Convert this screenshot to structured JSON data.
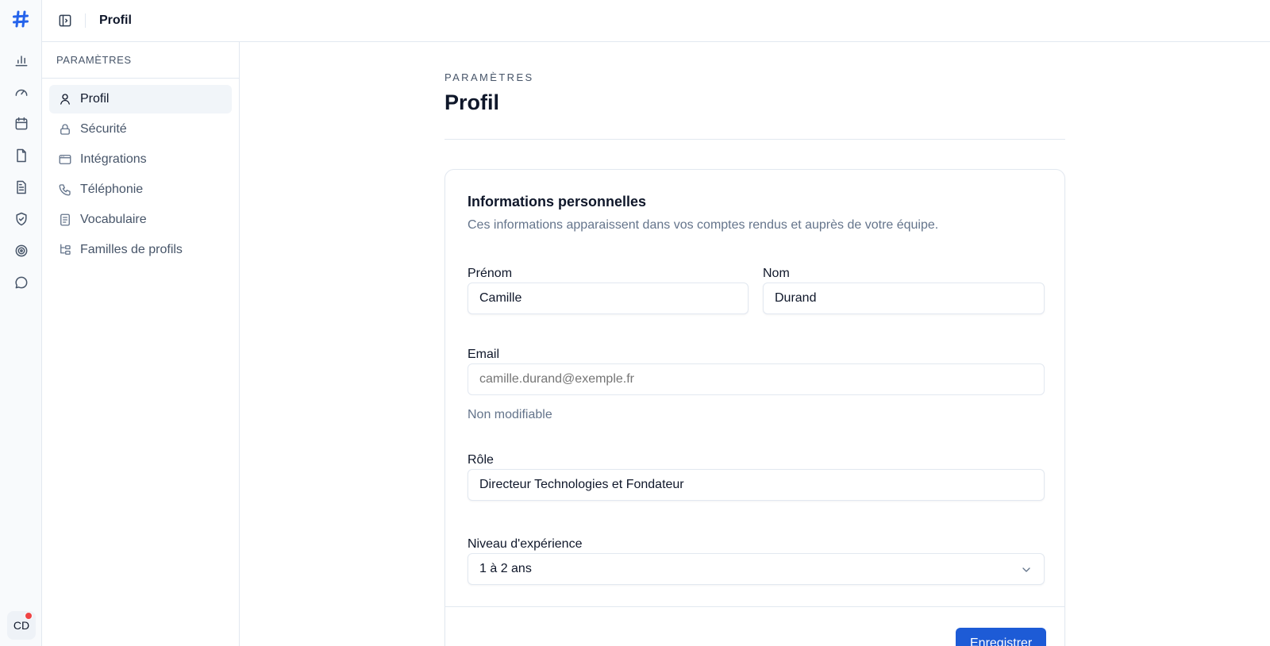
{
  "colors": {
    "accent": "#1d5bd6",
    "notification": "#ef4444"
  },
  "rail": {
    "icons": [
      "hash-logo-icon",
      "bar-chart-icon",
      "gauge-icon",
      "calendar-icon",
      "file-icon",
      "document-icon",
      "shield-check-icon",
      "target-icon",
      "chat-bubble-icon"
    ],
    "avatar_initials": "CD"
  },
  "topbar": {
    "title": "Profil"
  },
  "sidebar": {
    "heading": "PARAMÈTRES",
    "items": [
      {
        "label": "Profil",
        "icon": "user-icon",
        "active": true
      },
      {
        "label": "Sécurité",
        "icon": "lock-icon"
      },
      {
        "label": "Intégrations",
        "icon": "browser-window-icon"
      },
      {
        "label": "Téléphonie",
        "icon": "phone-icon"
      },
      {
        "label": "Vocabulaire",
        "icon": "book-icon"
      },
      {
        "label": "Familles de profils",
        "icon": "tree-icon"
      }
    ]
  },
  "page": {
    "eyebrow": "PARAMÈTRES",
    "title": "Profil"
  },
  "card": {
    "title": "Informations personnelles",
    "description": "Ces informations apparaissent dans vos comptes rendus et auprès de votre équipe.",
    "fields": {
      "first_name": {
        "label": "Prénom",
        "value": "Camille"
      },
      "last_name": {
        "label": "Nom",
        "value": "Durand"
      },
      "email": {
        "label": "Email",
        "placeholder": "camille.durand@exemple.fr",
        "hint": "Non modifiable"
      },
      "role": {
        "label": "Rôle",
        "value": "Directeur Technologies et Fondateur"
      },
      "experience": {
        "label": "Niveau d'expérience",
        "value": "1 à 2 ans"
      }
    },
    "save_label": "Enregistrer"
  }
}
